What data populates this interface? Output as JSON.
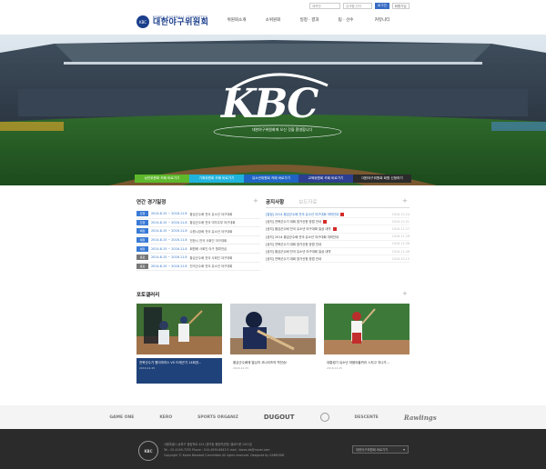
{
  "header": {
    "logo_sub": "KOREA BASEBALL COMMITTEE",
    "logo_main": "대한야구위원회",
    "util": {
      "select": "제목만",
      "search_placeholder": "검색할 단어",
      "login": "로그인",
      "join": "회원가입"
    },
    "nav": [
      "위원회소개",
      "소위원회",
      "일정 · 결과",
      "팀 · 선수",
      "커뮤니티"
    ]
  },
  "hero": {
    "title": "KBC",
    "caption": "대한야구위원회에 오신 것을 환영합니다"
  },
  "quick_links": [
    {
      "label": "상안위원회 카페 바로가기",
      "color": "#5eb82b"
    },
    {
      "label": "기획위원회 카페 바로가기",
      "color": "#20b3dc"
    },
    {
      "label": "유소년위원회 카페 바로가기",
      "color": "#1f64c3"
    },
    {
      "label": "교육위원회 카페 바로가기",
      "color": "#2c3e8f"
    },
    {
      "label": "대한야구위원회 회원 신청하기",
      "color": "#2b2b2b"
    }
  ],
  "schedule": {
    "title": "연간 경기일정",
    "rows": [
      {
        "badge": "진행",
        "badge_color": "#3a7bd5",
        "date": "2014.8.15 ~ 2016.11.8",
        "name": "황금군수배 전국 유소년 야구대회"
      },
      {
        "badge": "진행",
        "badge_color": "#3a7bd5",
        "date": "2014.8.15 ~ 2016.11.8",
        "name": "황금군수배 전국 여자주부 야구대회"
      },
      {
        "badge": "예정",
        "badge_color": "#3a7bd5",
        "date": "2014.8.15 ~ 2016.11.8",
        "name": "수원시장배 전국 유소년 야구대회"
      },
      {
        "badge": "예정",
        "badge_color": "#3a7bd5",
        "date": "2014.8.15 ~ 2016.11.8",
        "name": "전한시 전국 사회인 야구대회"
      },
      {
        "badge": "예정",
        "badge_color": "#3a7bd5",
        "date": "2014.8.15 ~ 2016.11.8",
        "name": "회원배 사회인 야구 챔피언십"
      },
      {
        "badge": "종료",
        "badge_color": "#777777",
        "date": "2014.8.15 ~ 2016.11.8",
        "name": "황금군수배 전국 사회인 야구대회"
      },
      {
        "badge": "종료",
        "badge_color": "#777777",
        "date": "2014.8.15 ~ 2016.11.8",
        "name": "전국군수배 전국 유소년 야구대회"
      }
    ]
  },
  "notice": {
    "tabs": [
      "공지사항",
      "보도자료"
    ],
    "rows": [
      {
        "text": "[알림] 2014 황금군수배 전국 유소년 야구대회 개최안내",
        "date": "2016.12.24",
        "highlight": true,
        "is_new": true
      },
      {
        "text": "[공지] 전북군수기 대회 참가신청 방법 안내",
        "date": "2016.12.01",
        "highlight": false,
        "is_new": true
      },
      {
        "text": "[공지] 황금군수배 전국 유소년 야구대회 일상 내역",
        "date": "2016.11.27",
        "highlight": false,
        "is_new": true
      },
      {
        "text": "[공지] 2014 황금군수배 전국 유소년 야구대회 개최안내",
        "date": "2016.11.26",
        "highlight": false,
        "is_new": false
      },
      {
        "text": "[공지] 전북군수기 대회 참가신청 방법 안내",
        "date": "2016.11.08",
        "highlight": false,
        "is_new": false
      },
      {
        "text": "[공지] 황금군수배 전국 유소년 야구대회 일상 내역",
        "date": "2016.11.08",
        "highlight": false,
        "is_new": false
      },
      {
        "text": "[공지] 전북군수기 대회 참가신청 방법 안내",
        "date": "2016.10.15",
        "highlight": false,
        "is_new": false
      }
    ]
  },
  "gallery": {
    "title": "포토갤러리",
    "items": [
      {
        "caption": "전북군수기 원더마치스 VS 드래곤기 14회권...",
        "date": "2016.12.25"
      },
      {
        "caption": "황금군수배에 열심히 코너리즈의 역전승!",
        "date": "2016.12.25"
      },
      {
        "caption": "대통령기 유소년 마음야울퀴리 스치고 지나가...",
        "date": "2016.12.25"
      }
    ]
  },
  "partners": [
    "GAME ONE",
    "KERO",
    "SPORTS ORGANIZ",
    "DUGOUT",
    "",
    "DESCENTE",
    "Rawlings"
  ],
  "footer": {
    "logo": "KBC",
    "address": "서울특별시 송파구 올림픽로 424 (방이동 올림픽공원) 벨로드롬 1001호",
    "contact": "Tel : 02-4249-7255    Phone : 010-4939-8843    E-mail : korea-bb@naver.com",
    "copyright": "Copyright © Korea Baseball Committee All rights reserved.  Designed by GAMEONE",
    "family_site": "대한야구위원회 바로가기"
  }
}
